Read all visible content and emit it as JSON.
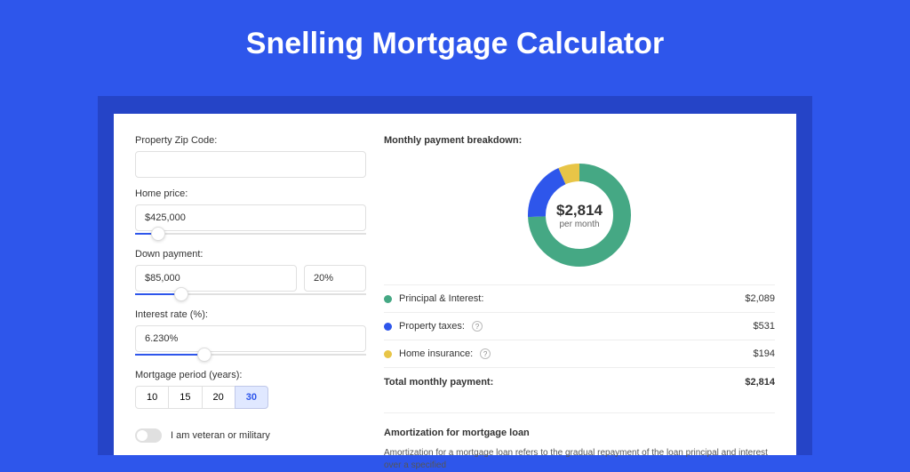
{
  "page_title": "Snelling Mortgage Calculator",
  "form": {
    "zip_label": "Property Zip Code:",
    "zip_value": "",
    "home_price_label": "Home price:",
    "home_price_value": "$425,000",
    "home_price_slider_pct": 10,
    "down_payment_label": "Down payment:",
    "down_payment_value": "$85,000",
    "down_payment_pct": "20%",
    "down_payment_slider_pct": 20,
    "rate_label": "Interest rate (%):",
    "rate_value": "6.230%",
    "rate_slider_pct": 30,
    "period_label": "Mortgage period (years):",
    "periods": [
      "10",
      "15",
      "20",
      "30"
    ],
    "period_selected": "30",
    "veteran_label": "I am veteran or military"
  },
  "breakdown": {
    "title": "Monthly payment breakdown:",
    "center_value": "$2,814",
    "center_sub": "per month",
    "items": [
      {
        "label": "Principal & Interest:",
        "value": "$2,089",
        "color": "green",
        "help": false
      },
      {
        "label": "Property taxes:",
        "value": "$531",
        "color": "blue",
        "help": true
      },
      {
        "label": "Home insurance:",
        "value": "$194",
        "color": "yellow",
        "help": true
      }
    ],
    "total_label": "Total monthly payment:",
    "total_value": "$2,814"
  },
  "amort": {
    "title": "Amortization for mortgage loan",
    "text": "Amortization for a mortgage loan refers to the gradual repayment of the loan principal and interest over a specified"
  },
  "chart_data": {
    "type": "pie",
    "title": "Monthly payment breakdown",
    "series": [
      {
        "name": "Principal & Interest",
        "value": 2089,
        "color": "#45a884"
      },
      {
        "name": "Property taxes",
        "value": 531,
        "color": "#2e56eb"
      },
      {
        "name": "Home insurance",
        "value": 194,
        "color": "#e8c547"
      }
    ],
    "total": 2814
  }
}
